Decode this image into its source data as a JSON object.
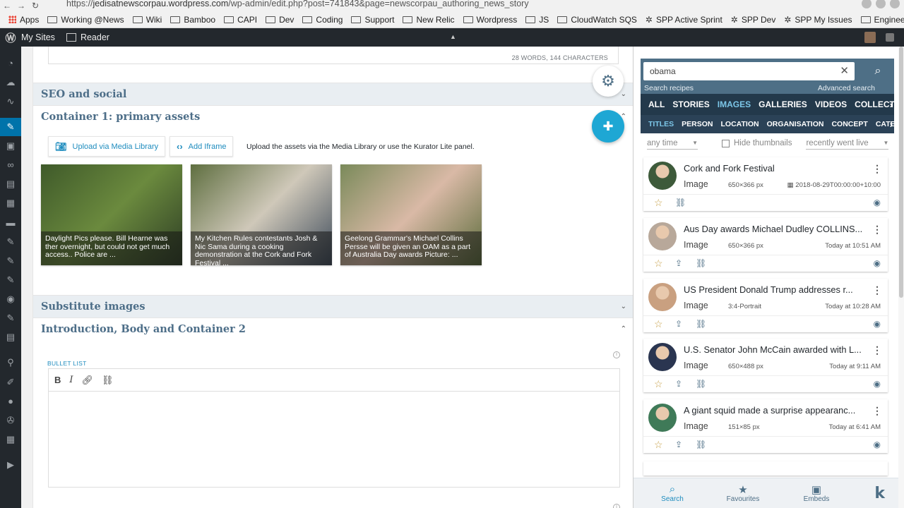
{
  "browser": {
    "url_prefix": "https://",
    "url_host": "jedisatnewscorpau.wordpress.com",
    "url_path": "/wp-admin/edit.php?post=741843&page=newscorpau_authoring_news_story",
    "bookmarks": [
      {
        "label": "Apps",
        "icon": "apps-grid-icon"
      },
      {
        "label": "Working @News",
        "icon": "folder-icon"
      },
      {
        "label": "Wiki",
        "icon": "folder-icon"
      },
      {
        "label": "Bamboo",
        "icon": "folder-icon"
      },
      {
        "label": "CAPI",
        "icon": "folder-icon"
      },
      {
        "label": "Dev",
        "icon": "folder-icon"
      },
      {
        "label": "Coding",
        "icon": "folder-icon"
      },
      {
        "label": "Support",
        "icon": "folder-icon"
      },
      {
        "label": "New Relic",
        "icon": "folder-icon"
      },
      {
        "label": "Wordpress",
        "icon": "folder-icon"
      },
      {
        "label": "JS",
        "icon": "folder-icon"
      },
      {
        "label": "CloudWatch SQS",
        "icon": "folder-icon"
      },
      {
        "label": "SPP Active Sprint",
        "icon": "jira-icon"
      },
      {
        "label": "SPP Dev",
        "icon": "jira-icon"
      },
      {
        "label": "SPP My Issues",
        "icon": "jira-icon"
      },
      {
        "label": "Engineering",
        "icon": "folder-icon"
      }
    ]
  },
  "adminbar": {
    "my_sites": "My Sites",
    "reader": "Reader"
  },
  "editor": {
    "word_count": "28 WORDS, 144 CHARACTERS",
    "sections": {
      "seo": "SEO and social",
      "container1": "Container 1: primary assets",
      "substitute": "Substitute images",
      "intro": "Introduction, Body and Container 2"
    },
    "upload_label": "Upload via Media Library",
    "iframe_label": "Add Iframe",
    "upload_help": "Upload the assets via the Media Library or use the Kurator Lite panel.",
    "assets": [
      {
        "caption": "Daylight Pics please. Bill Hearne was ther overnight, but could not get much access.. Police are ...",
        "colors": [
          "#3f5a2a",
          "#6b8a3e",
          "#2d3d24"
        ]
      },
      {
        "caption": "My Kitchen Rules contestants Josh & Nic Sama during a cooking demonstration at the Cork and Fork Festival ...",
        "colors": [
          "#5f6f40",
          "#cfc8b9",
          "#3d4a5a"
        ]
      },
      {
        "caption": "Geelong Grammar's Michael Collins Persse will be given an OAM as a part of Australia Day awards Picture: ...",
        "colors": [
          "#7a8a5a",
          "#d9b9a6",
          "#5a6b3a"
        ]
      }
    ],
    "bullet_list_label": "BULLET LIST",
    "toolbar": {
      "bold": "B",
      "italic": "I"
    }
  },
  "panel": {
    "search_value": "obama",
    "search_recipes": "Search recipes",
    "advanced_search": "Advanced search",
    "tabs": [
      "ALL",
      "STORIES",
      "IMAGES",
      "GALLERIES",
      "VIDEOS",
      "COLLECTIO"
    ],
    "active_tab": "IMAGES",
    "subtabs": [
      "TITLES",
      "PERSON",
      "LOCATION",
      "ORGANISATION",
      "CONCEPT",
      "CATEG"
    ],
    "active_subtab": "TITLES",
    "filter_time": "any time",
    "hide_thumbnails": "Hide thumbnails",
    "sort": "recently went live",
    "results": [
      {
        "title": "Cork and Fork Festival",
        "type": "Image",
        "dims": "650×366 px",
        "time": "2018-08-29T00:00:00+10:00",
        "has_calendar": true,
        "has_embed": false,
        "avatar_color": "#3d5a3a"
      },
      {
        "title": "Aus Day awards Michael Dudley COLLINS...",
        "type": "Image",
        "dims": "650×366 px",
        "time": "Today at 10:51 AM",
        "has_calendar": false,
        "has_embed": true,
        "avatar_color": "#b8a89a"
      },
      {
        "title": "US President Donald Trump addresses r...",
        "type": "Image",
        "dims": "3:4-Portrait",
        "time": "Today at 10:28 AM",
        "has_calendar": false,
        "has_embed": true,
        "avatar_color": "#c9a080"
      },
      {
        "title": "U.S. Senator John McCain awarded with L...",
        "type": "Image",
        "dims": "650×488 px",
        "time": "Today at 9:11 AM",
        "has_calendar": false,
        "has_embed": true,
        "avatar_color": "#2a3550"
      },
      {
        "title": "A giant squid made a surprise appearanc...",
        "type": "Image",
        "dims": "151×85 px",
        "time": "Today at 6:41 AM",
        "has_calendar": false,
        "has_embed": true,
        "avatar_color": "#3f7a58"
      }
    ],
    "bottom_nav": [
      {
        "label": "Search",
        "icon": "search-icon"
      },
      {
        "label": "Favourites",
        "icon": "star-icon"
      },
      {
        "label": "Embeds",
        "icon": "embed-icon"
      }
    ],
    "active_nav": "Search"
  }
}
